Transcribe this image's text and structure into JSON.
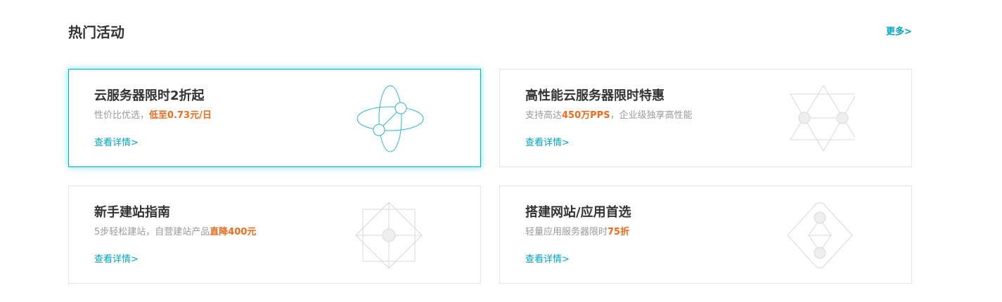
{
  "section": {
    "title": "热门活动",
    "more_label": "更多>"
  },
  "cards": [
    {
      "title": "云服务器限时2折起",
      "desc_prefix": "性价比优选，",
      "desc_highlight": "低至0.73元/日",
      "desc_suffix": "",
      "link_label": "查看详情>",
      "icon": "orbit-icon"
    },
    {
      "title": "高性能云服务器限时特惠",
      "desc_prefix": "支持高达",
      "desc_highlight": "450万PPS",
      "desc_suffix": "，企业级独享高性能",
      "link_label": "查看详情>",
      "icon": "hexagram-icon"
    },
    {
      "title": "新手建站指南",
      "desc_prefix": "5步轻松建站，自营建站产品",
      "desc_highlight": "直降400元",
      "desc_suffix": "",
      "link_label": "查看详情>",
      "icon": "nested-squares-icon"
    },
    {
      "title": "搭建网站/应用首选",
      "desc_prefix": "轻量应用服务器限时",
      "desc_highlight": "75折",
      "desc_suffix": "",
      "link_label": "查看详情>",
      "icon": "double-diamond-icon"
    }
  ],
  "colors": {
    "accent": "#00a3c2",
    "highlight": "#f06a1a",
    "active_border": "#00b4c8",
    "icon_active": "#2bb8d0",
    "icon_inactive": "#d8d8d8"
  }
}
